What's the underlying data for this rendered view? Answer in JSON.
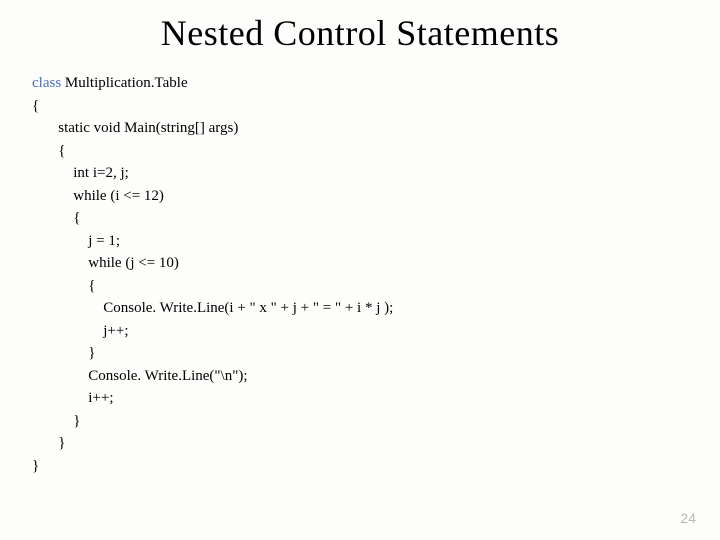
{
  "title": "Nested Control Statements",
  "code": {
    "kw_class": "class",
    "class_name": " Multiplication.Table",
    "l1": "{",
    "l2": "       static void Main(string[] args)",
    "l3": "       {",
    "l4": "           int i=2, j;",
    "l5": "           while (i <= 12)",
    "l6": "           {",
    "l7": "               j = 1;",
    "l8": "               while (j <= 10)",
    "l9": "               {",
    "l10": "                   Console. Write.Line(i + \" x \" + j + \" = \" + i * j );",
    "l11": "                   j++;",
    "l12": "               }",
    "l13": "               Console. Write.Line(\"\\n\");",
    "l14": "               i++;",
    "l15": "           }",
    "l16": "       }",
    "l17": "}"
  },
  "page_number": "24"
}
